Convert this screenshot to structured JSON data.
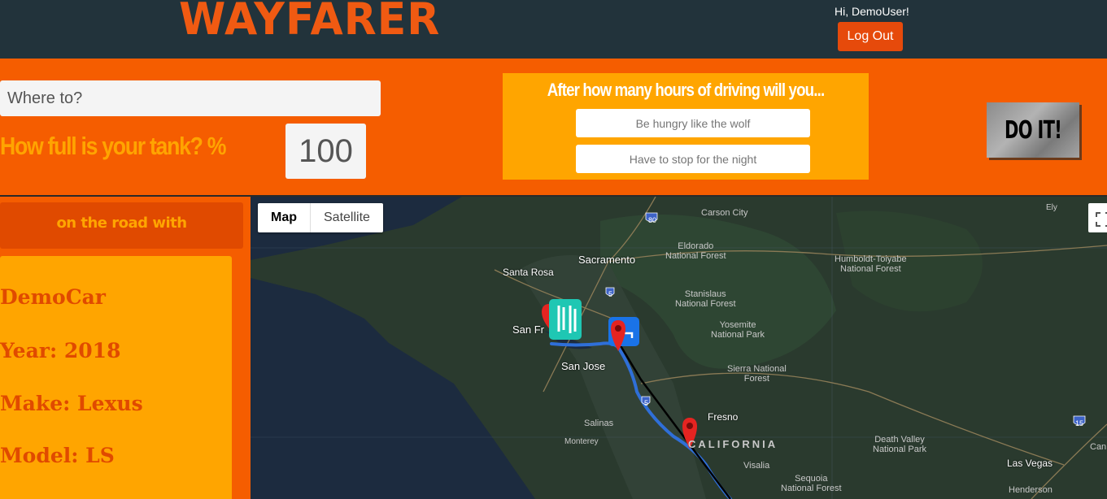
{
  "header": {
    "logo_text": "WAYFARER",
    "greeting": "Hi, DemoUser!",
    "logout_label": "Log Out"
  },
  "trip_form": {
    "destination_placeholder": "Where to?",
    "tank_label": "How full is your tank? %",
    "tank_value": "100",
    "hours_title": "After how many hours of driving will you...",
    "hungry_placeholder": "Be hungry like the wolf",
    "night_placeholder": "Have to stop for the night",
    "submit_label": "DO IT!"
  },
  "sidebar": {
    "road_header": "on the road with",
    "car_name": "DemoCar",
    "year": "Year: 2018",
    "make": "Make: Lexus",
    "model": "Model: LS"
  },
  "map": {
    "type_map_label": "Map",
    "type_satellite_label": "Satellite",
    "places": {
      "carson_city": "Carson City",
      "eldorado": "Eldorado\nNational Forest",
      "humboldt": "Humboldt-Toiyabe\nNational Forest",
      "ely": "Ely",
      "santa_rosa": "Santa Rosa",
      "sacramento": "Sacramento",
      "stanislaus": "Stanislaus\nNational Forest",
      "yosemite": "Yosemite\nNational Park",
      "san_francisco": "San Fr",
      "san_jose": "San Jose",
      "sierra": "Sierra National\nForest",
      "fresno": "Fresno",
      "salinas": "Salinas",
      "monterey": "Monterey",
      "california": "CALIFORNIA",
      "visalia": "Visalia",
      "death_valley": "Death Valley\nNational Park",
      "las_vegas": "Las Vegas",
      "sequoia": "Sequoia\nNational Forest",
      "henderson": "Henderson",
      "canyon_partial": "Can",
      "route_80": "80",
      "route_5a": "5",
      "route_5b": "5",
      "route_15": "15"
    },
    "colors": {
      "route": "#2f6fd8",
      "marker": "#e52421",
      "food_marker": "#1fc7b3",
      "hotel_marker": "#1a73e8"
    },
    "icons": [
      "food-marker-icon",
      "hotel-marker-icon",
      "location-pin-icon"
    ]
  }
}
